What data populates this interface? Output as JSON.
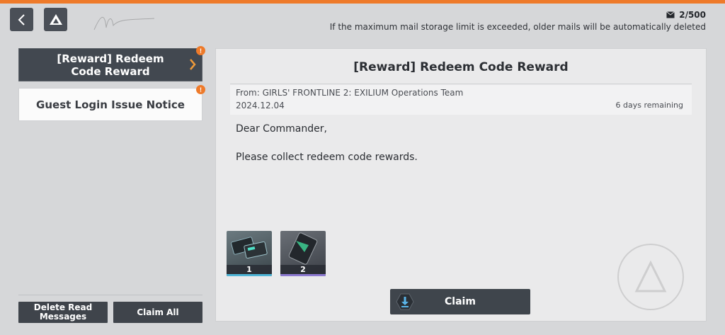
{
  "header": {
    "mail_count": "2/500",
    "storage_note": "If the maximum mail storage limit is exceeded, older mails will be automatically deleted"
  },
  "mail_list": [
    {
      "title": "[Reward] Redeem Code Reward",
      "tag": "",
      "state": "selected",
      "alert": "!"
    },
    {
      "title": "Guest Login Issue Notice",
      "tag": "",
      "state": "unread",
      "alert": "!"
    }
  ],
  "actions": {
    "delete_label": "Delete Read Messages",
    "claim_all_label": "Claim All"
  },
  "detail": {
    "title": "[Reward] Redeem Code Reward",
    "from": "From: GIRLS' FRONTLINE 2: EXILIUM Operations Team",
    "date": "2024.12.04",
    "remaining": "6 days remaining",
    "greeting": "Dear Commander,",
    "body": "Please collect redeem code rewards.",
    "rewards": [
      {
        "quantity": "1",
        "icon": "data-chip-icon"
      },
      {
        "quantity": "2",
        "icon": "key-card-icon"
      }
    ],
    "claim_label": "Claim"
  },
  "colors": {
    "accent": "#ee7a2a",
    "dark_button": "#3f444b",
    "background": "#d6d7d9",
    "panel": "#eaeaeb"
  }
}
